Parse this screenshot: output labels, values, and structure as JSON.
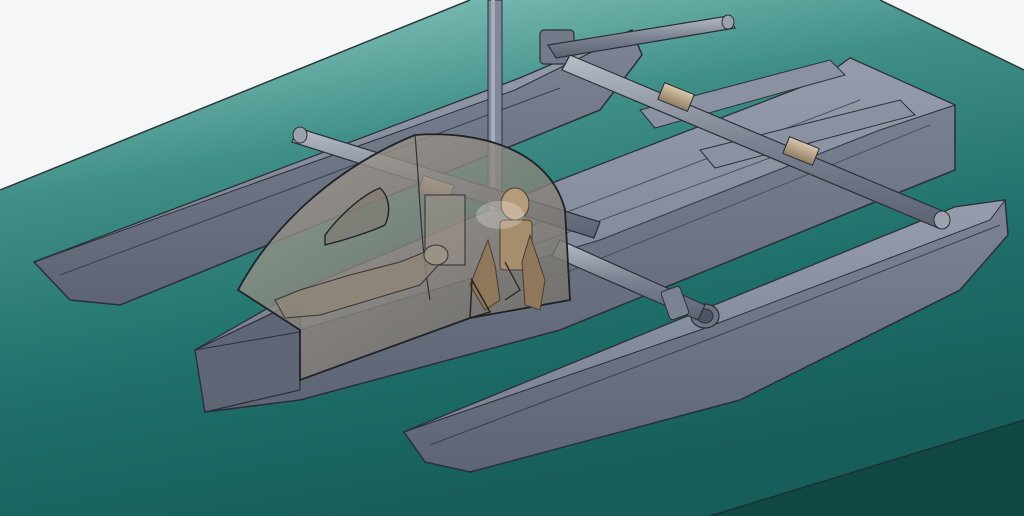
{
  "scene": {
    "subject": "trimaran-3d-model",
    "colors": {
      "background": "#f4f6f7",
      "water_light": "#8fcdc6",
      "water_dark": "#1f6f6a",
      "water_deep": "#14514f",
      "hull": "#6f7787",
      "hull_light": "#8b93a2",
      "hull_dark": "#555d6c",
      "edge": "#2b2f38",
      "pipe": "#7b8291",
      "pipe_light": "#a3aab6",
      "sleeve": "#b5a389",
      "canopy": "#8a8175",
      "figure": "#a0876a",
      "mast": "#80889a"
    }
  }
}
